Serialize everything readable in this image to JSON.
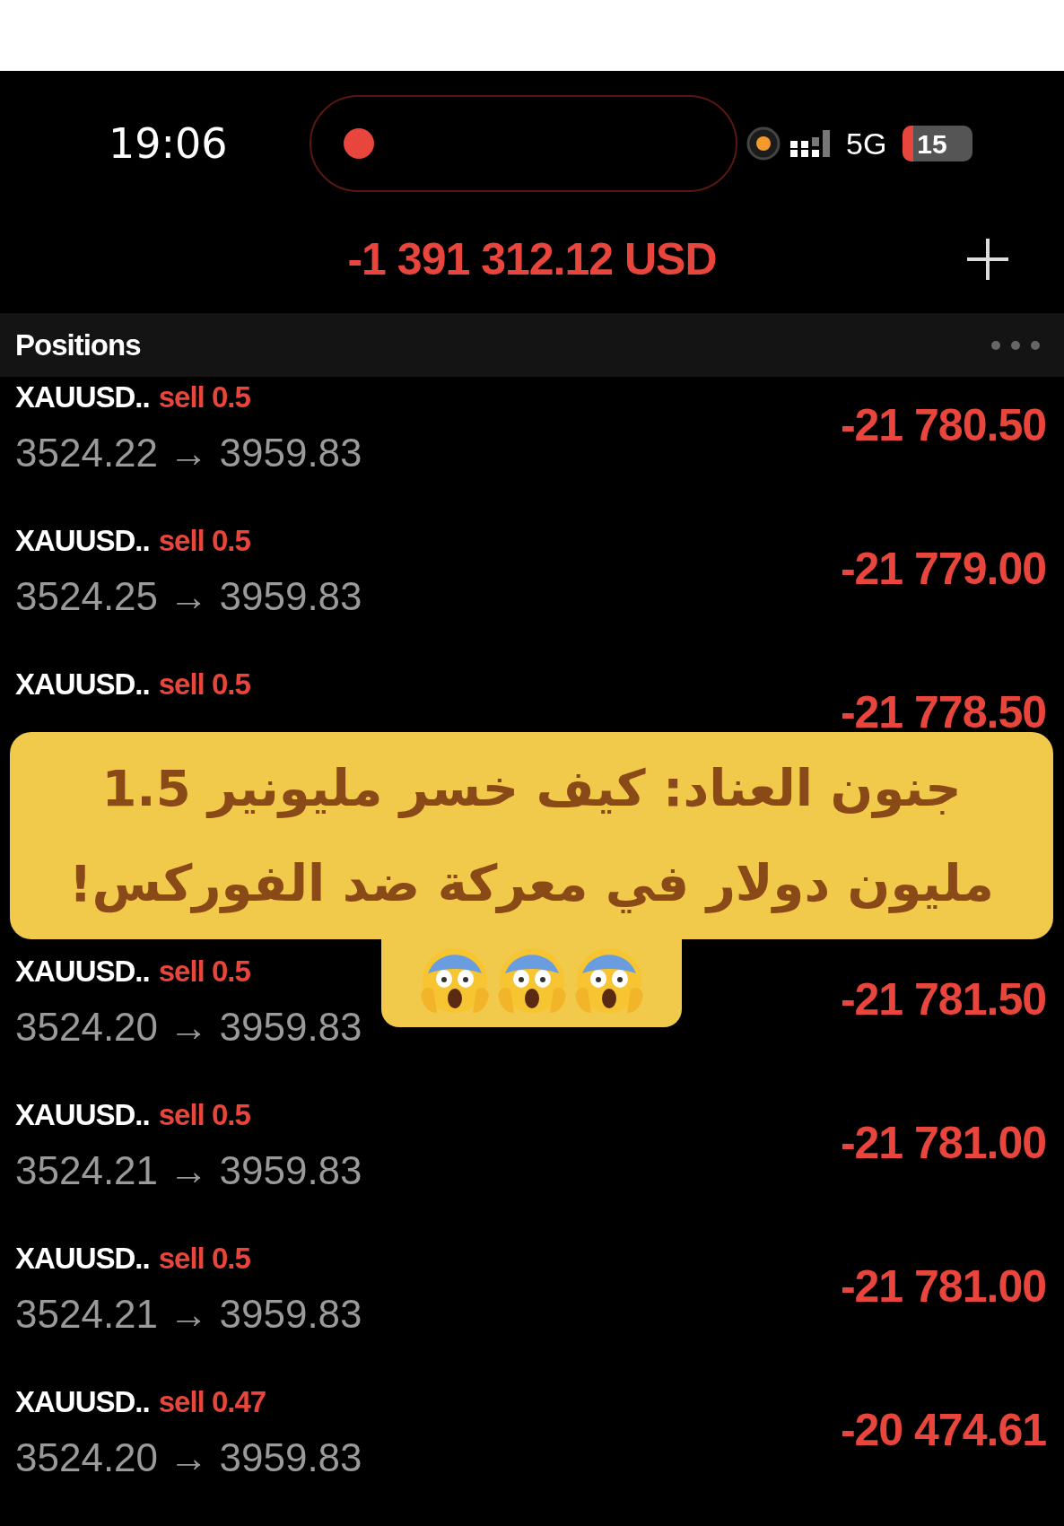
{
  "status_bar": {
    "time": "19:06",
    "network": "5G",
    "battery": "15"
  },
  "balance": "-1 391 312.12 USD",
  "section": {
    "title": "Positions"
  },
  "rows": [
    {
      "symbol": "XAUUSD..",
      "side": "sell 0.5",
      "prices": "3524.22 → 3959.83",
      "profit": "-21 780.50"
    },
    {
      "symbol": "XAUUSD..",
      "side": "sell 0.5",
      "prices": "3524.25 → 3959.83",
      "profit": "-21 779.00"
    },
    {
      "symbol": "XAUUSD..",
      "side": "sell 0.5",
      "profit": "-21 778.50"
    },
    {
      "symbol": "XAUUSD..",
      "side": "sell 0.5",
      "prices": "3524.20 → 3959.83",
      "profit": "-21 781.50"
    },
    {
      "symbol": "XAUUSD..",
      "side": "sell 0.5",
      "prices": "3524.21 → 3959.83",
      "profit": "-21 781.00"
    },
    {
      "symbol": "XAUUSD..",
      "side": "sell 0.5",
      "prices": "3524.21 → 3959.83",
      "profit": "-21 781.00"
    },
    {
      "symbol": "XAUUSD..",
      "side": "sell 0.47",
      "prices": "3524.20 → 3959.83",
      "profit": "-20 474.61"
    }
  ],
  "caption": {
    "lines": [
      "جنون العناد: كيف خسر مليونير 1.5",
      "مليون دولار في معركة ضد الفوركس!"
    ]
  }
}
